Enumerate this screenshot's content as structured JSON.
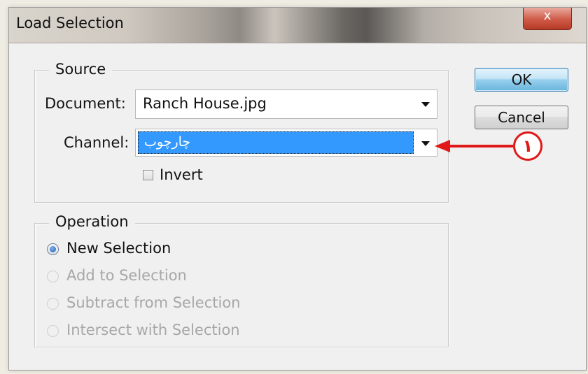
{
  "window": {
    "title": "Load Selection",
    "close_glyph": "x"
  },
  "source": {
    "legend": "Source",
    "document_label": "Document:",
    "document_value": "Ranch House.jpg",
    "channel_label": "Channel:",
    "channel_value": "چارچوب",
    "invert_label": "Invert",
    "invert_checked": false
  },
  "operation": {
    "legend": "Operation",
    "options": [
      {
        "label": "New Selection",
        "checked": true,
        "enabled": true
      },
      {
        "label": "Add to Selection",
        "checked": false,
        "enabled": false
      },
      {
        "label": "Subtract from Selection",
        "checked": false,
        "enabled": false
      },
      {
        "label": "Intersect with Selection",
        "checked": false,
        "enabled": false
      }
    ]
  },
  "buttons": {
    "ok_label": "OK",
    "cancel_label": "Cancel"
  },
  "annotation": {
    "callout_number": "١",
    "color": "#e01818"
  },
  "colors": {
    "selection_highlight": "#3399ff",
    "default_button_accent": "#68b3db"
  }
}
